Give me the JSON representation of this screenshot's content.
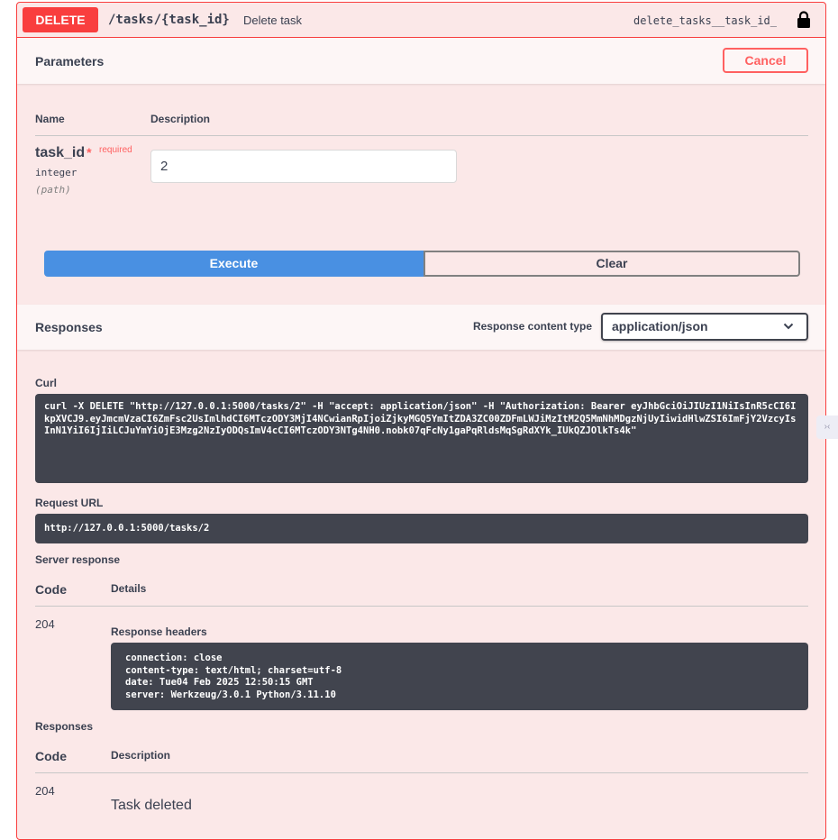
{
  "operation": {
    "method": "DELETE",
    "path": "/tasks/{task_id}",
    "summary": "Delete task",
    "operation_id": "delete_tasks__task_id_",
    "method_color": "#f93e3e"
  },
  "parameters": {
    "title": "Parameters",
    "cancel_label": "Cancel",
    "col_name": "Name",
    "col_description": "Description",
    "items": [
      {
        "name": "task_id",
        "required_star": "*",
        "required_label": "required",
        "type": "integer",
        "in": "(path)",
        "value": "2"
      }
    ]
  },
  "actions": {
    "execute_label": "Execute",
    "clear_label": "Clear",
    "execute_color": "#4990e2"
  },
  "responses_header": {
    "title": "Responses",
    "content_type_label": "Response content type",
    "content_type_value": "application/json"
  },
  "curl": {
    "label": "Curl",
    "command": "curl -X DELETE \"http://127.0.0.1:5000/tasks/2\" -H \"accept: application/json\" -H \"Authorization: Bearer eyJhbGciOiJIUzI1NiIsInR5cCI6IkpXVCJ9.eyJmcmVzaCI6ZmFsc2UsImlhdCI6MTczODY3MjI4NCwianRpIjoiZjkyMGQ5YmItZDA3ZC00ZDFmLWJiMzItM2Q5MmNhMDgzNjUyIiwidHlwZSI6ImFjY2VzcyIsInN1YiI6IjIiLCJuYmYiOjE3Mzg2NzIyODQsImV4cCI6MTczODY3NTg4NH0.nobk07qFcNy1gaPqRldsMqSgRdXYk_IUkQZJOlkTs4k\""
  },
  "request_url": {
    "label": "Request URL",
    "value": "http://127.0.0.1:5000/tasks/2"
  },
  "server_response": {
    "label": "Server response",
    "col_code": "Code",
    "col_details": "Details",
    "code": "204",
    "headers_label": "Response headers",
    "headers": "connection: close\ncontent-type: text/html; charset=utf-8\ndate: Tue04 Feb 2025 12:50:15 GMT\nserver: Werkzeug/3.0.1 Python/3.11.10"
  },
  "responses": {
    "label": "Responses",
    "col_code": "Code",
    "col_description": "Description",
    "rows": [
      {
        "code": "204",
        "description": "Task deleted"
      }
    ]
  },
  "side_tab": {
    "label": "›‹"
  }
}
